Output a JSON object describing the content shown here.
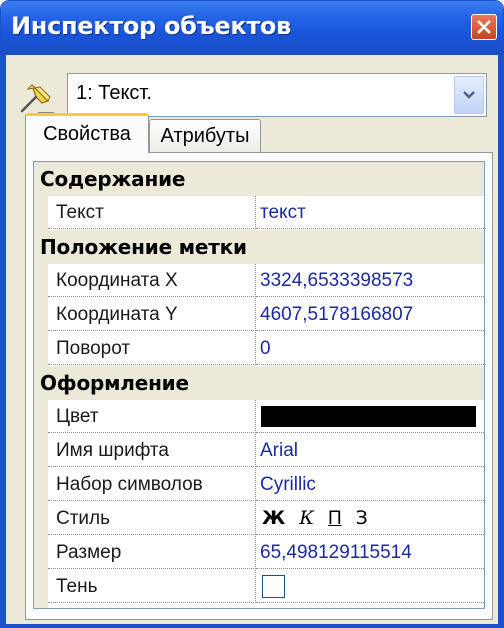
{
  "window": {
    "title": "Инспектор объектов",
    "accent_color": "#1e50c9",
    "close_icon": "close-icon"
  },
  "object_selector": {
    "icon": "pin-marker-icon",
    "selected": "1: Текст."
  },
  "tabs": [
    {
      "label": "Свойства",
      "active": true
    },
    {
      "label": "Атрибуты",
      "active": false
    }
  ],
  "grid": {
    "categories": {
      "content": "Содержание",
      "position": "Положение метки",
      "appearance": "Оформление"
    },
    "props": {
      "text": {
        "name": "Текст",
        "value": "текст"
      },
      "coord_x": {
        "name": "Координата X",
        "value": "3324,6533398573"
      },
      "coord_y": {
        "name": "Координата Y",
        "value": "4607,5178166807"
      },
      "rotation": {
        "name": "Поворот",
        "value": "0"
      },
      "color": {
        "name": "Цвет",
        "value": "#000000"
      },
      "font_name": {
        "name": "Имя шрифта",
        "value": "Arial"
      },
      "charset": {
        "name": "Набор символов",
        "value": "Cyrillic"
      },
      "style": {
        "name": "Стиль",
        "bold": "Ж",
        "italic": "К",
        "underline": "П",
        "strike": "З"
      },
      "size": {
        "name": "Размер",
        "value": "65,498129115514"
      },
      "shadow": {
        "name": "Тень",
        "checked": false
      }
    }
  }
}
